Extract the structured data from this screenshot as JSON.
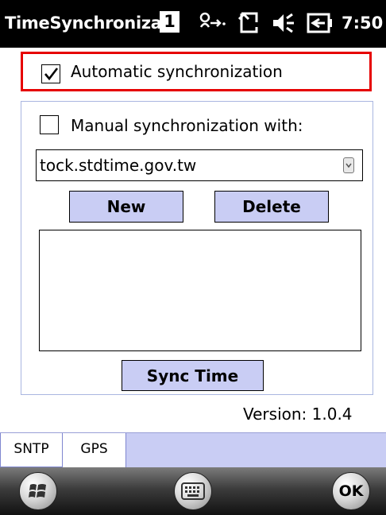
{
  "window": {
    "title": "TimeSynchroniza",
    "clock": "7:50",
    "pin_badge": "1"
  },
  "auto_sync": {
    "label": "Automatic synchronization",
    "checked": true
  },
  "manual_sync": {
    "label": "Manual synchronization with:",
    "checked": false
  },
  "server_select": {
    "value": "tock.stdtime.gov.tw"
  },
  "buttons": {
    "new": "New",
    "delete": "Delete",
    "sync_time": "Sync Time"
  },
  "version": "Version: 1.0.4",
  "tabs": [
    {
      "label": "SNTP",
      "active": true
    },
    {
      "label": "GPS",
      "active": false
    }
  ],
  "softkeys": {
    "ok": "OK"
  },
  "icons": {
    "title_bar": [
      "pin-badge-icon",
      "connectivity-icon",
      "network-icon",
      "volume-icon",
      "battery-icon"
    ],
    "softbar": [
      "start-windows-icon",
      "keyboard-icon",
      "ok-icon"
    ]
  },
  "colors": {
    "accent_frame": "#e60000",
    "button_fill": "#c9cdf4",
    "title_bar": "#000000"
  }
}
